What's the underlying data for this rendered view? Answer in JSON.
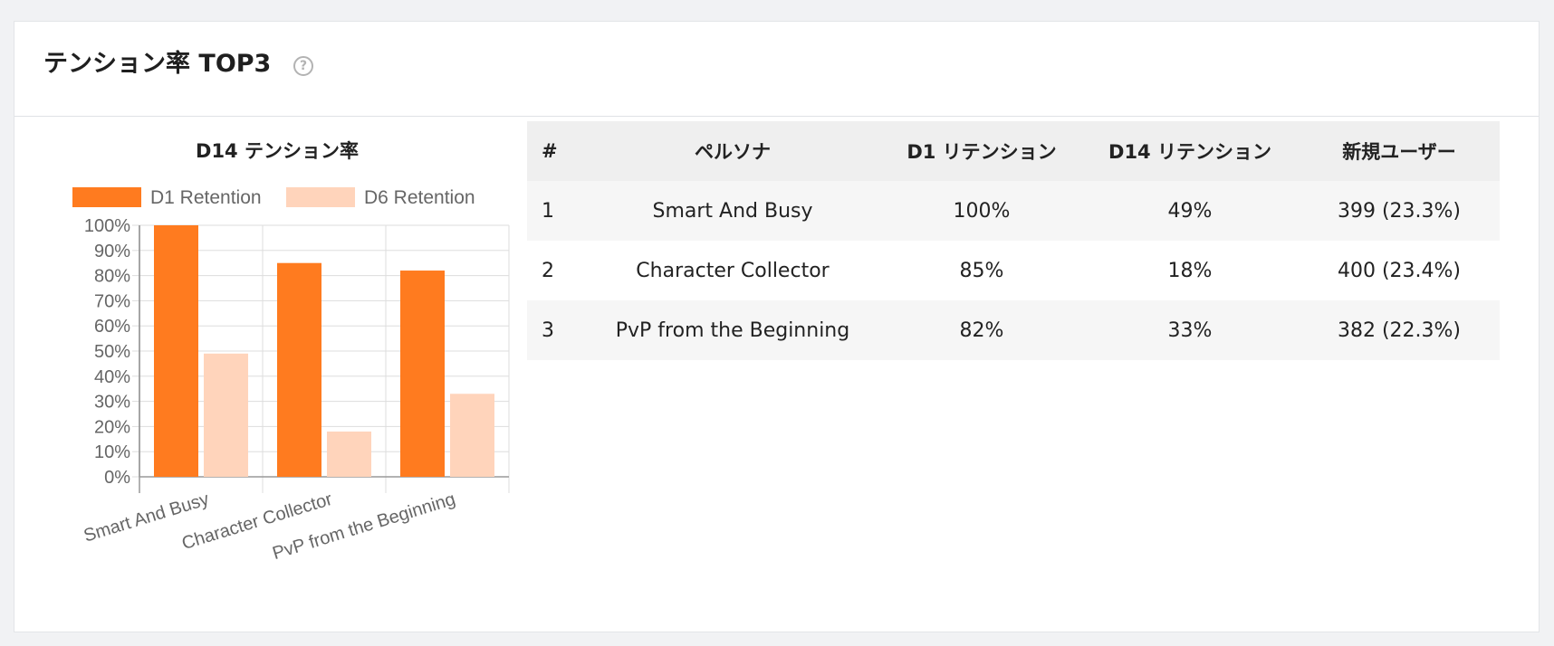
{
  "card": {
    "title": "テンション率 TOP3",
    "help_icon": "question-circle-icon"
  },
  "colors": {
    "d1": "#ff7b1f",
    "d6": "#ffd4bb",
    "grid": "#dddddd",
    "axis_text": "#666666"
  },
  "chart_data": {
    "type": "bar",
    "title": "D14 テンション率",
    "categories": [
      "Smart And Busy",
      "Character Collector",
      "PvP from the Beginning"
    ],
    "series": [
      {
        "name": "D1 Retention",
        "values": [
          100,
          85,
          82
        ]
      },
      {
        "name": "D6 Retention",
        "values": [
          49,
          18,
          33
        ]
      }
    ],
    "y_ticks": [
      "100%",
      "90%",
      "80%",
      "70%",
      "60%",
      "50%",
      "40%",
      "30%",
      "20%",
      "10%",
      "0%"
    ],
    "ylim": [
      0,
      100
    ],
    "grid": true,
    "legend": "top"
  },
  "table": {
    "headers": [
      "#",
      "ペルソナ",
      "D1 リテンション",
      "D14 リテンション",
      "新規ユーザー"
    ],
    "rows": [
      {
        "idx": "1",
        "name": "Smart And Busy",
        "d1": "100%",
        "d14": "49%",
        "new_users": "399 (23.3%)"
      },
      {
        "idx": "2",
        "name": "Character Collector",
        "d1": "85%",
        "d14": "18%",
        "new_users": "400 (23.4%)"
      },
      {
        "idx": "3",
        "name": "PvP from the Beginning",
        "d1": "82%",
        "d14": "33%",
        "new_users": "382 (22.3%)"
      }
    ]
  }
}
